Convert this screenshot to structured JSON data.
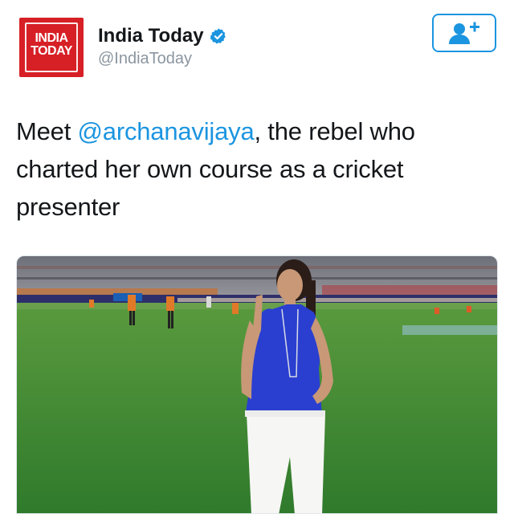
{
  "account": {
    "logo_text": "INDIA TODAY",
    "display_name": "India Today",
    "handle": "@IndiaToday",
    "verified": true
  },
  "tweet": {
    "text_before": "Meet ",
    "mention": "@archanavijaya",
    "text_after": ", the rebel who charted her own course as a cricket presenter"
  },
  "icons": {
    "verified": "verified-badge-icon",
    "follow": "add-user-icon"
  },
  "colors": {
    "brand_red": "#d71f26",
    "link_blue": "#1b95e0",
    "text_dark": "#14171a",
    "text_muted": "#8b96a0",
    "pitch_green": "#3f8a33",
    "dress_blue": "#2a3fd0"
  }
}
